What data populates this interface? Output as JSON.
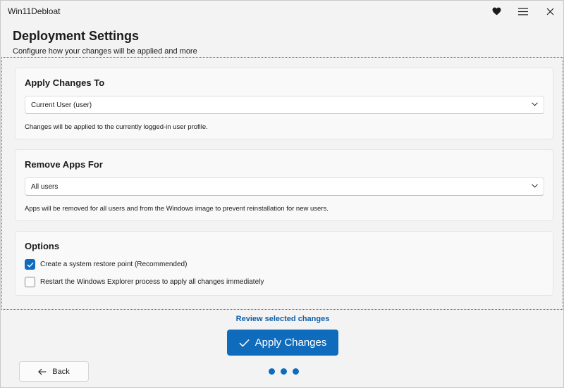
{
  "window": {
    "title": "Win11Debloat",
    "heart_icon": "heart-icon",
    "menu_icon": "hamburger-menu-icon",
    "close_icon": "close-icon"
  },
  "header": {
    "title": "Deployment Settings",
    "subtitle": "Configure how your changes will be applied and more"
  },
  "cards": {
    "apply_to": {
      "title": "Apply Changes To",
      "selected": "Current User (user)",
      "description": "Changes will be applied to the currently logged-in user profile."
    },
    "remove_apps": {
      "title": "Remove Apps For",
      "selected": "All users",
      "description": "Apps will be removed for all users and from the Windows image to prevent reinstallation for new users."
    },
    "options": {
      "title": "Options",
      "items": [
        {
          "label": "Create a system restore point (Recommended)",
          "checked": true
        },
        {
          "label": "Restart the Windows Explorer process to apply all changes immediately",
          "checked": false
        }
      ]
    }
  },
  "footer": {
    "review_link": "Review selected changes",
    "apply_label": "Apply Changes",
    "back_label": "Back",
    "step_dots": 3
  },
  "colors": {
    "accent": "#0f6cbd",
    "link": "#0f5fa8",
    "background": "#f3f3f3",
    "card": "#f9f9f9"
  }
}
